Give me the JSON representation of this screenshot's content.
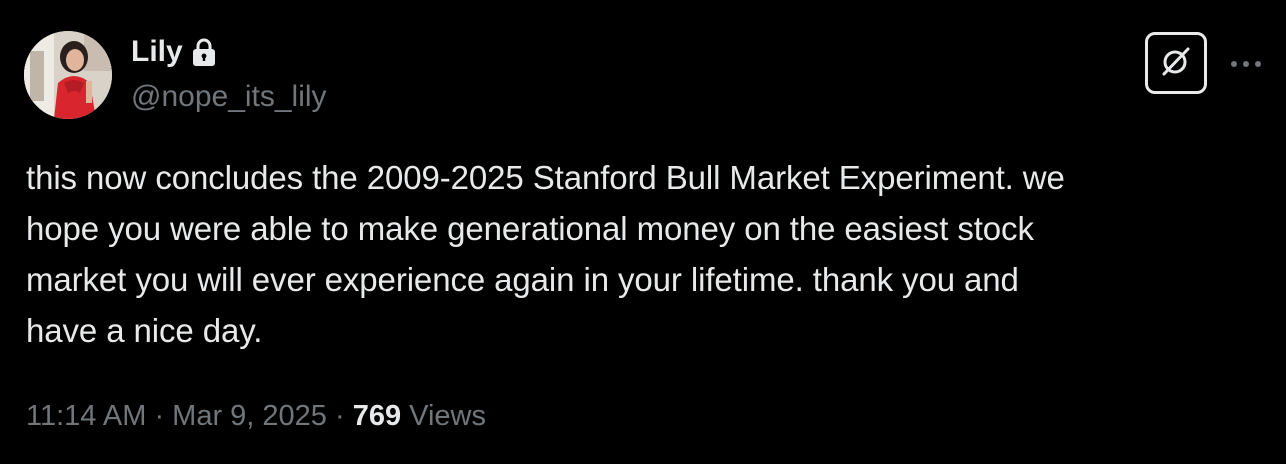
{
  "author": {
    "display_name": "Lily",
    "handle": "@nope_its_lily",
    "protected_icon": "lock-icon",
    "avatar_icon": "avatar-photo"
  },
  "actions": {
    "grok_icon": "grok-icon",
    "more_icon": "more-horizontal-icon"
  },
  "tweet": {
    "lines": [
      "this now concludes the 2009-2025 Stanford Bull Market Experiment. we",
      "hope you were able to make generational money on the easiest stock",
      "market you will ever experience again in your lifetime. thank you and",
      "have a nice day."
    ]
  },
  "meta": {
    "time": "11:14 AM",
    "separator": " · ",
    "date": "Mar 9, 2025",
    "views_count": "769",
    "views_label": " Views"
  },
  "colors": {
    "background": "#000000",
    "primary_text": "#e7e9ea",
    "secondary_text": "#71767b"
  }
}
